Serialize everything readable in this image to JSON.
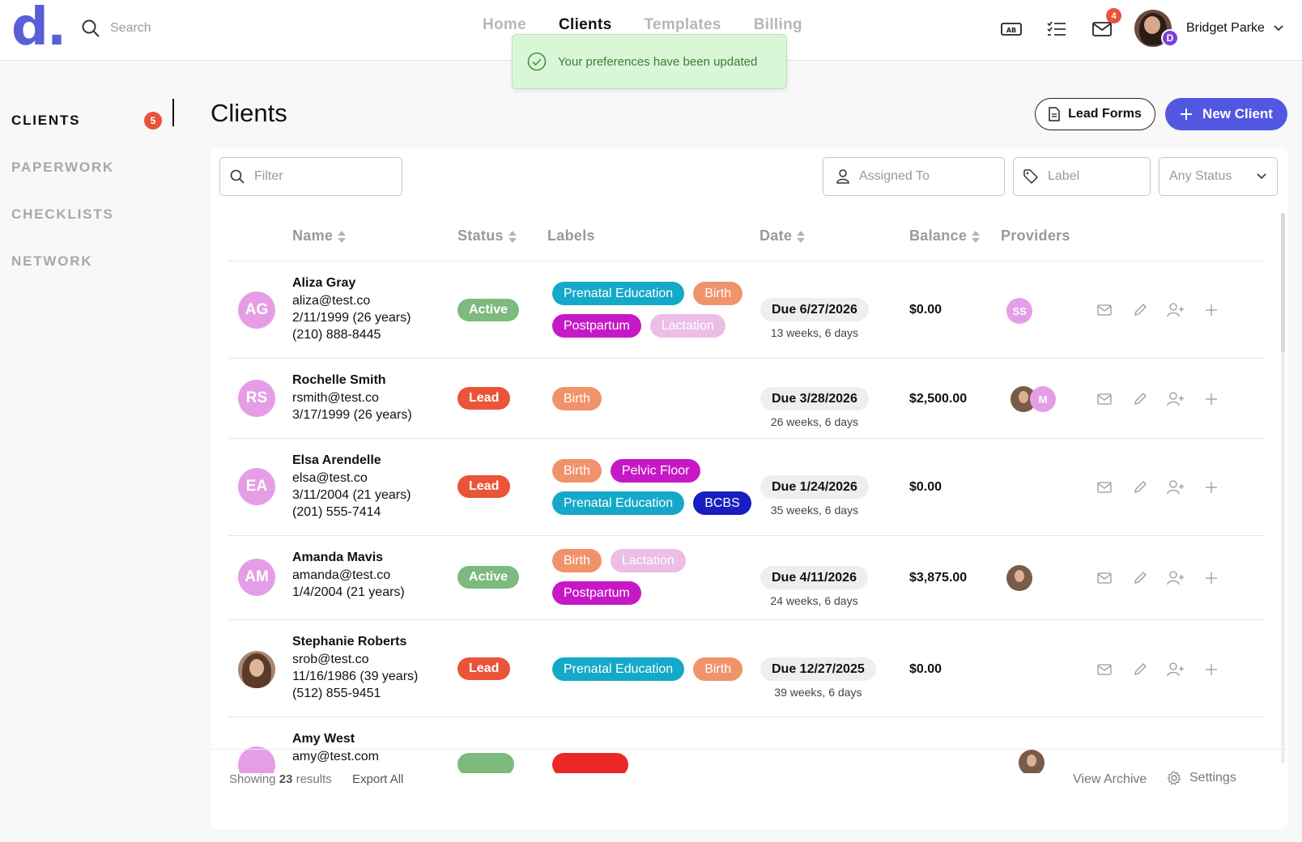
{
  "header": {
    "logo": "d.",
    "search_placeholder": "Search",
    "nav": [
      {
        "label": "Home"
      },
      {
        "label": "Clients"
      },
      {
        "label": "Templates"
      },
      {
        "label": "Billing"
      }
    ],
    "nav_active": "Clients",
    "inbox_badge": "4",
    "user": {
      "name": "Bridget Parke",
      "initial": "D"
    }
  },
  "toast": {
    "message": "Your preferences have been updated"
  },
  "sidebar": {
    "items": [
      {
        "label": "CLIENTS",
        "count": "5"
      },
      {
        "label": "PAPERWORK"
      },
      {
        "label": "CHECKLISTS"
      },
      {
        "label": "NETWORK"
      }
    ]
  },
  "page": {
    "title": "Clients",
    "lead_forms_label": "Lead Forms",
    "new_client_label": "New Client"
  },
  "filters": {
    "filter_placeholder": "Filter",
    "assigned_placeholder": "Assigned To",
    "label_placeholder": "Label",
    "status_value": "Any Status"
  },
  "table": {
    "columns": {
      "name": "Name",
      "status": "Status",
      "labels": "Labels",
      "date": "Date",
      "balance": "Balance",
      "providers": "Providers"
    },
    "rows": [
      {
        "initials": "AG",
        "name": "Aliza Gray",
        "email": "aliza@test.co",
        "dob": "2/11/1999 (26 years)",
        "phone": "(210) 888-8445",
        "status": "Active",
        "labels": [
          {
            "text": "Prenatal Education",
            "color": "#14a9c9"
          },
          {
            "text": "Birth",
            "color": "#f0936a"
          },
          {
            "text": "Postpartum",
            "color": "#c618c6"
          },
          {
            "text": "Lactation",
            "color": "#ecbde7"
          }
        ],
        "due": "Due 6/27/2026",
        "due_sub": "13 weeks, 6 days",
        "balance": "$0.00",
        "provider": "SS"
      },
      {
        "initials": "RS",
        "name": "Rochelle Smith",
        "email": "rsmith@test.co",
        "dob": "3/17/1999 (26 years)",
        "phone": "",
        "status": "Lead",
        "labels": [
          {
            "text": "Birth",
            "color": "#f0936a"
          }
        ],
        "due": "Due 3/28/2026",
        "due_sub": "26 weeks, 6 days",
        "balance": "$2,500.00",
        "provider": "M"
      },
      {
        "initials": "EA",
        "name": "Elsa Arendelle",
        "email": "elsa@test.co",
        "dob": "3/11/2004 (21 years)",
        "phone": "(201) 555-7414",
        "status": "Lead",
        "labels": [
          {
            "text": "Birth",
            "color": "#f0936a"
          },
          {
            "text": "Pelvic Floor",
            "color": "#c618c6"
          },
          {
            "text": "Prenatal Education",
            "color": "#14a9c9"
          },
          {
            "text": "BCBS",
            "color": "#1a1ec0"
          }
        ],
        "due": "Due 1/24/2026",
        "due_sub": "35 weeks, 6 days",
        "balance": "$0.00",
        "provider": ""
      },
      {
        "initials": "AM",
        "name": "Amanda Mavis",
        "email": "amanda@test.co",
        "dob": "1/4/2004 (21 years)",
        "phone": "",
        "status": "Active",
        "labels": [
          {
            "text": "Birth",
            "color": "#f0936a"
          },
          {
            "text": "Lactation",
            "color": "#ecbde7"
          },
          {
            "text": "Postpartum",
            "color": "#c618c6"
          }
        ],
        "due": "Due 4/11/2026",
        "due_sub": "24 weeks, 6 days",
        "balance": "$3,875.00",
        "provider": ""
      },
      {
        "initials": "",
        "name": "Stephanie Roberts",
        "email": "srob@test.co",
        "dob": "11/16/1986 (39 years)",
        "phone": "(512) 855-9451",
        "status": "Lead",
        "labels": [
          {
            "text": "Prenatal Education",
            "color": "#14a9c9"
          },
          {
            "text": "Birth",
            "color": "#f0936a"
          }
        ],
        "due": "Due 12/27/2025",
        "due_sub": "39 weeks, 6 days",
        "balance": "$0.00",
        "provider": ""
      },
      {
        "initials": "",
        "name": "Amy West",
        "email": "amy@test.com",
        "dob": "",
        "phone": "",
        "status": "",
        "labels": [],
        "due": "",
        "due_sub": "",
        "balance": "",
        "provider": ""
      }
    ]
  },
  "footer": {
    "showing_prefix": "Showing",
    "count": "23",
    "showing_suffix": "results",
    "export": "Export All",
    "archive": "View Archive",
    "settings": "Settings"
  }
}
